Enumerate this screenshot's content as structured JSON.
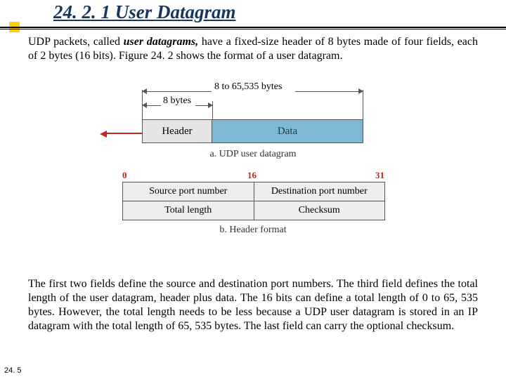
{
  "title": "24. 2. 1  User Datagram",
  "para1": {
    "pre": "UDP packets, called ",
    "em": "user datagrams,",
    "post": " have a fixed-size header of 8 bytes made of four fields, each of 2 bytes (16 bits). Figure 24. 2 shows the format of a user datagram."
  },
  "diagram": {
    "range_total": "8 to 65,535 bytes",
    "range_header": "8 bytes",
    "box_header": "Header",
    "box_data": "Data",
    "caption_a": "a. UDP user datagram",
    "bits": {
      "b0": "0",
      "b16": "16",
      "b31": "31"
    },
    "fields": {
      "src": "Source port number",
      "dst": "Destination port number",
      "len": "Total length",
      "chk": "Checksum"
    },
    "caption_b": "b. Header format"
  },
  "para2": "The first two fields define the source and destination port numbers. The third field defines the total length of the user datagram, header plus data. The 16 bits can define a total length of 0 to 65, 535 bytes. However, the total length needs to be less because a UDP user datagram is stored in an IP datagram with the total length of 65, 535 bytes. The last field can carry the optional checksum.",
  "page": "24. 5"
}
